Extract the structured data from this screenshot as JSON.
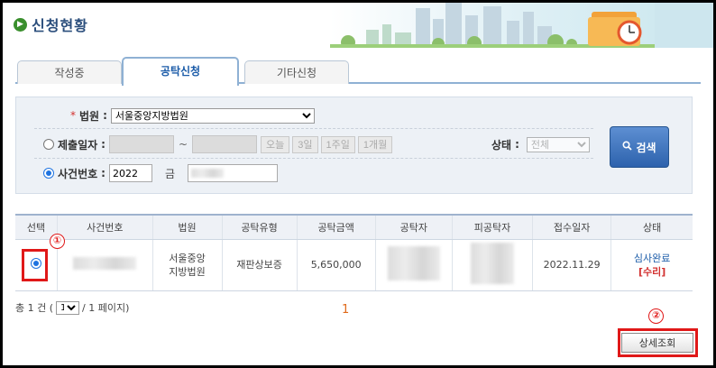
{
  "header": {
    "title": "신청현황"
  },
  "tabs": [
    {
      "label": "작성중"
    },
    {
      "label": "공탁신청"
    },
    {
      "label": "기타신청"
    }
  ],
  "search": {
    "court_label": "법원",
    "court_value": "서울중앙지방법원",
    "date_label": "제출일자",
    "date_sep": "~",
    "date_buttons": [
      "오늘",
      "3일",
      "1주일",
      "1개월"
    ],
    "status_label": "상태",
    "status_value": "전체",
    "case_label": "사건번호",
    "case_year": "2022",
    "case_type": "금",
    "search_button": "검색"
  },
  "table": {
    "headers": [
      "선택",
      "사건번호",
      "법원",
      "공탁유형",
      "공탁금액",
      "공탁자",
      "피공탁자",
      "접수일자",
      "상태"
    ],
    "row": {
      "court_line1": "서울중앙",
      "court_line2": "지방법원",
      "type": "재판상보증",
      "amount": "5,650,000",
      "date": "2022.11.29",
      "status": "심사완료",
      "status_sub": "[수리]"
    }
  },
  "pager": {
    "total_prefix": "총 1 건 (",
    "page_select": "1",
    "total_suffix": "/ 1 페이지)",
    "current_page": "1"
  },
  "annotations": {
    "marker1": "①",
    "marker2": "②"
  },
  "detail_button": "상세조회",
  "colors": {
    "accent": "#1a5ba8",
    "highlight": "#e01818",
    "search_button": "#3a6fb8"
  }
}
